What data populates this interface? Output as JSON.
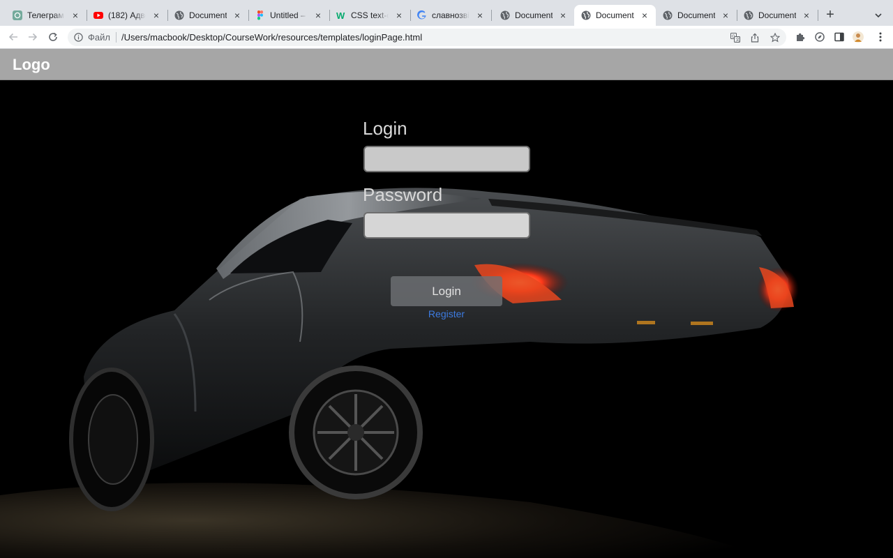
{
  "browser": {
    "tabs": [
      {
        "title": "Телеграм-б",
        "icon": "chatgpt-icon",
        "active": false
      },
      {
        "title": "(182) Адвок",
        "icon": "youtube-icon",
        "active": false
      },
      {
        "title": "Document",
        "icon": "globe-icon",
        "active": false
      },
      {
        "title": "Untitled – F",
        "icon": "figma-icon",
        "active": false
      },
      {
        "title": "CSS text-de",
        "icon": "w3schools-icon",
        "active": false
      },
      {
        "title": "славнозвіс",
        "icon": "google-icon",
        "active": false
      },
      {
        "title": "Document",
        "icon": "globe-icon",
        "active": false
      },
      {
        "title": "Document",
        "icon": "globe-icon",
        "active": true
      },
      {
        "title": "Document",
        "icon": "globe-icon",
        "active": false
      },
      {
        "title": "Document",
        "icon": "globe-icon",
        "active": false
      }
    ],
    "address_bar": {
      "scheme_label": "Файл",
      "url": "/Users/macbook/Desktop/CourseWork/resources/templates/loginPage.html"
    },
    "colors": {
      "tabstrip": "#dee1e6",
      "active_tab": "#ffffff",
      "omnibox": "#f1f3f4"
    }
  },
  "page": {
    "header": {
      "logo": "Logo"
    },
    "form": {
      "login_label": "Login",
      "login_value": "",
      "password_label": "Password",
      "password_value": "",
      "submit_label": "Login",
      "register_link": "Register"
    },
    "colors": {
      "header_bg": "#a6a6a6",
      "link": "#3d7be0",
      "input_bg": "#c9c9c9",
      "label": "#d9d9d9"
    }
  }
}
